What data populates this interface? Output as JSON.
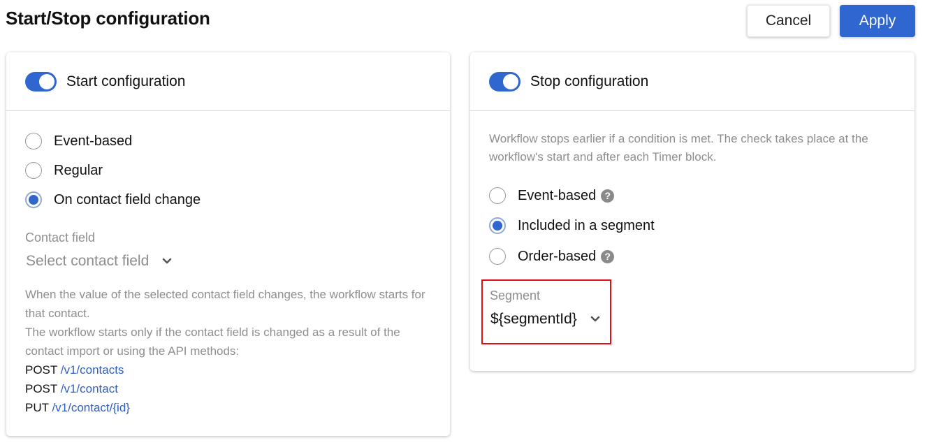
{
  "header": {
    "title": "Start/Stop configuration",
    "cancel_label": "Cancel",
    "apply_label": "Apply"
  },
  "colors": {
    "accent": "#2f66cf",
    "link": "#2f5fbf",
    "muted_text": "#8e8e8e",
    "highlight_border": "#e10d17"
  },
  "start": {
    "toggle_on": true,
    "title": "Start configuration",
    "options": [
      {
        "label": "Event-based",
        "checked": false
      },
      {
        "label": "Regular",
        "checked": false
      },
      {
        "label": "On contact field change",
        "checked": true
      }
    ],
    "field_label": "Contact field",
    "field_placeholder": "Select contact field",
    "hint_1": "When the value of the selected contact field changes, the workflow starts for that contact.",
    "hint_2": "The workflow starts only if the contact field is changed as a result of the contact import or using the API methods:",
    "api_methods": [
      {
        "method": "POST",
        "path": "/v1/contacts"
      },
      {
        "method": "POST",
        "path": "/v1/contact"
      },
      {
        "method": "PUT",
        "path": "/v1/contact/{id}"
      }
    ]
  },
  "stop": {
    "toggle_on": true,
    "title": "Stop configuration",
    "description": "Workflow stops earlier if a condition is met. The check takes place at the workflow's start and after each Timer block.",
    "options": [
      {
        "label": "Event-based",
        "checked": false,
        "help_icon": "question-circle-icon"
      },
      {
        "label": "Included in a segment",
        "checked": true
      },
      {
        "label": "Order-based",
        "checked": false,
        "help_icon": "question-circle-icon"
      }
    ],
    "segment_label": "Segment",
    "segment_value": "${segmentId}"
  },
  "icons": {
    "help": "?"
  }
}
